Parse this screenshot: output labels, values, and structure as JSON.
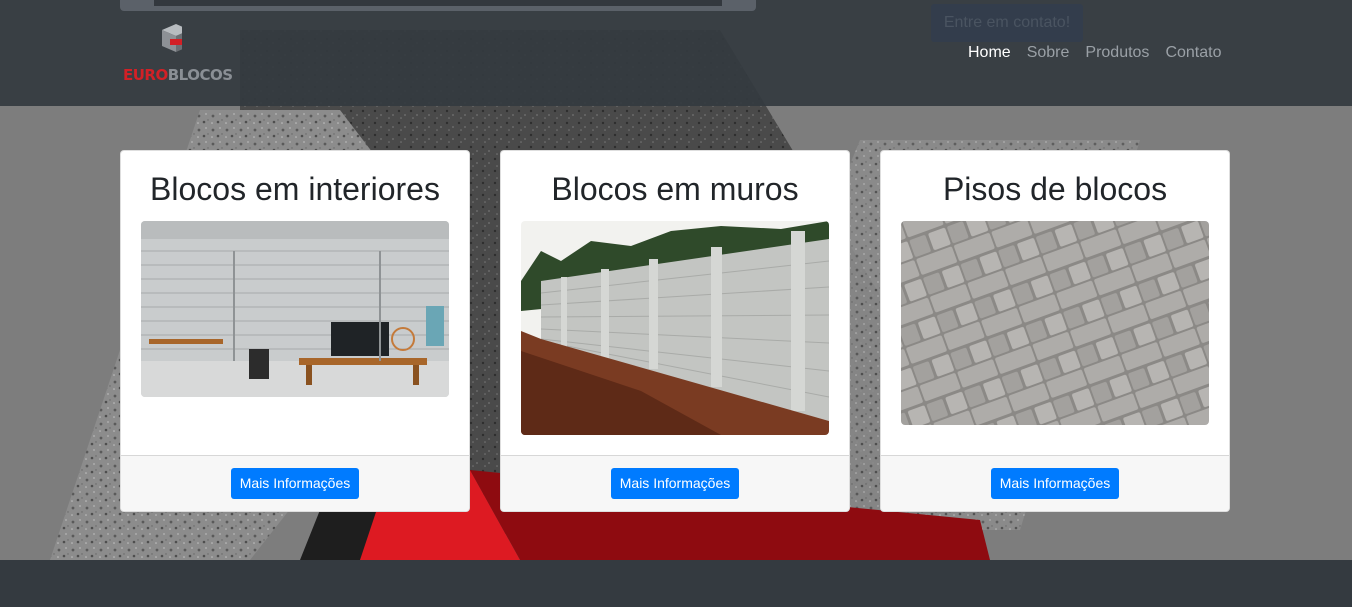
{
  "brand": {
    "name_part1": "EURO",
    "name_part2": "BLOCOS"
  },
  "header": {
    "cta_label": "Entre em contato!"
  },
  "nav": [
    {
      "label": "Home",
      "active": true
    },
    {
      "label": "Sobre",
      "active": false
    },
    {
      "label": "Produtos",
      "active": false
    },
    {
      "label": "Contato",
      "active": false
    }
  ],
  "cards": [
    {
      "title": "Blocos em interiores",
      "button": "Mais Informações",
      "image": "interior-room-photo"
    },
    {
      "title": "Blocos em muros",
      "button": "Mais Informações",
      "image": "block-wall-photo"
    },
    {
      "title": "Pisos de blocos",
      "button": "Mais Informações",
      "image": "paver-floor-photo"
    }
  ],
  "colors": {
    "navbar": "#343a40",
    "accent": "#007bff",
    "brand_red": "#d32026"
  }
}
